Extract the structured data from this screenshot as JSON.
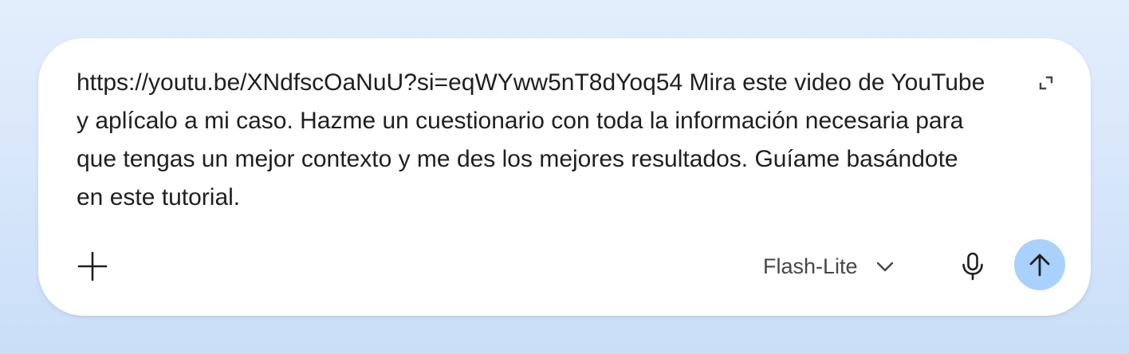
{
  "composer": {
    "prompt_text": "https://youtu.be/XNdfscOaNuU?si=eqWYww5nT8dYoq54 Mira este video de YouTube y aplícalo a mi caso. Hazme un cuestionario con toda la información necesaria para que tengas un mejor contexto y me des los mejores resultados. Guíame basándote en este tutorial.",
    "expand_icon": "expand-icon",
    "add_icon": "plus-icon",
    "model_selector": {
      "selected": "Flash-Lite",
      "icon": "chevron-down-icon"
    },
    "mic_icon": "microphone-icon",
    "send_icon": "arrow-up-icon"
  },
  "colors": {
    "send_button_bg": "#a8d2fb",
    "send_icon": "#1f1f1f",
    "text": "#1f1f1f",
    "muted_text": "#444746"
  }
}
